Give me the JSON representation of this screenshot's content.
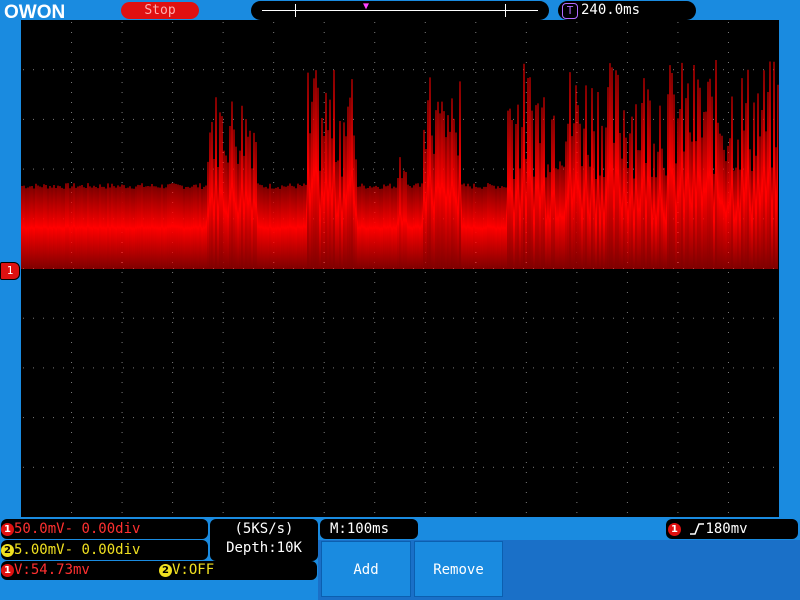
{
  "header": {
    "brand": "OWON",
    "run_state": "Stop",
    "timebase_offset": "240.0ms",
    "timebase_badge": "T"
  },
  "scope": {
    "ch1_marker": "1",
    "trace_color": "#ff0000",
    "grid_color": "#7a7a7a"
  },
  "channels": {
    "ch1": {
      "badge": "1",
      "volts_div": "50.0mV-",
      "offset": "0.00div",
      "color": "#ff3030"
    },
    "ch2": {
      "badge": "2",
      "volts_div": "5.00mV-",
      "offset": "0.00div",
      "color": "#f0e020"
    }
  },
  "acquisition": {
    "sample_rate": "(5KS/s)",
    "depth": "Depth:10K"
  },
  "readouts": {
    "ch1_badge": "1",
    "ch1_value": "V:54.73mv",
    "ch2_badge": "2",
    "ch2_value": "V:OFF"
  },
  "timebase": {
    "label": "M:100ms"
  },
  "trigger": {
    "badge": "1",
    "level": "180mv"
  },
  "menu": {
    "add_label": "Add",
    "remove_label": "Remove"
  }
}
